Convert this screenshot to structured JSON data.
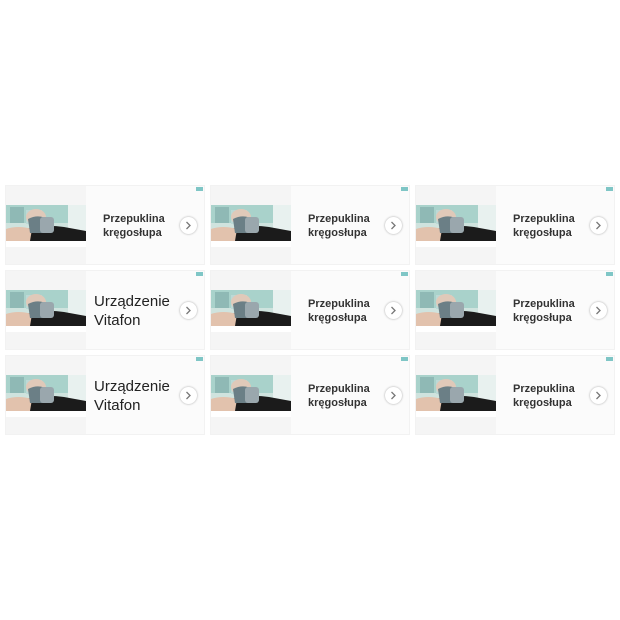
{
  "ad_grid": {
    "tiles": [
      {
        "headline": "Przepuklina kręgosłupa",
        "style": "bold",
        "thumbnail": "massage-treatment-photo",
        "arrow_icon": "chevron-right-icon",
        "badge_icon": "adchoices-icon"
      },
      {
        "headline": "Przepuklina kręgosłupa",
        "style": "bold",
        "thumbnail": "massage-treatment-photo",
        "arrow_icon": "chevron-right-icon",
        "badge_icon": "adchoices-icon"
      },
      {
        "headline": "Przepuklina kręgosłupa",
        "style": "bold",
        "thumbnail": "massage-treatment-photo",
        "arrow_icon": "chevron-right-icon",
        "badge_icon": "adchoices-icon"
      },
      {
        "headline": "Urządzenie Vitafon",
        "style": "large",
        "thumbnail": "massage-treatment-photo",
        "arrow_icon": "chevron-right-icon",
        "badge_icon": "adchoices-icon"
      },
      {
        "headline": "Przepuklina kręgosłupa",
        "style": "bold",
        "thumbnail": "massage-treatment-photo",
        "arrow_icon": "chevron-right-icon",
        "badge_icon": "adchoices-icon"
      },
      {
        "headline": "Przepuklina kręgosłupa",
        "style": "bold",
        "thumbnail": "massage-treatment-photo",
        "arrow_icon": "chevron-right-icon",
        "badge_icon": "adchoices-icon"
      },
      {
        "headline": "Urządzenie Vitafon",
        "style": "large",
        "thumbnail": "massage-treatment-photo",
        "arrow_icon": "chevron-right-icon",
        "badge_icon": "adchoices-icon"
      },
      {
        "headline": "Przepuklina kręgosłupa",
        "style": "bold",
        "thumbnail": "massage-treatment-photo",
        "arrow_icon": "chevron-right-icon",
        "badge_icon": "adchoices-icon"
      },
      {
        "headline": "Przepuklina kręgosłupa",
        "style": "bold",
        "thumbnail": "massage-treatment-photo",
        "arrow_icon": "chevron-right-icon",
        "badge_icon": "adchoices-icon"
      }
    ]
  },
  "colors": {
    "page_background": "#ffffff",
    "tile_background": "#fbfbfb",
    "headline_text": "#333333",
    "adchoices_badge": "#7fc6c6"
  }
}
